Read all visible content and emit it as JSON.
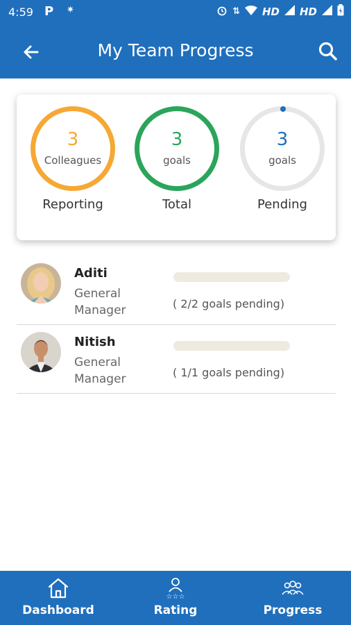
{
  "status_bar": {
    "time": "4:59",
    "network_1": "HD",
    "network_2": "HD"
  },
  "app_bar": {
    "title": "My Team Progress",
    "back_icon": "arrow-left-icon",
    "search_icon": "search-icon"
  },
  "summary": [
    {
      "value": "3",
      "unit": "Colleagues",
      "label": "Reporting",
      "color": "#f5a934",
      "progress": 1.0
    },
    {
      "value": "3",
      "unit": "goals",
      "label": "Total",
      "color": "#2aa55b",
      "progress": 1.0
    },
    {
      "value": "3",
      "unit": "goals",
      "label": "Pending",
      "color": "#1f6fbd",
      "progress": 0.0
    }
  ],
  "members": [
    {
      "name": "Aditi",
      "role": "General Manager",
      "pending": "( 2/2 goals pending)",
      "progress": 0.0
    },
    {
      "name": "Nitish",
      "role": "General Manager",
      "pending": "( 1/1 goals pending)",
      "progress": 0.0
    }
  ],
  "bottom_nav": [
    {
      "label": "Dashboard",
      "icon": "home-icon"
    },
    {
      "label": "Rating",
      "icon": "rating-icon"
    },
    {
      "label": "Progress",
      "icon": "team-icon"
    }
  ],
  "colors": {
    "primary": "#1f6fbd",
    "reporting": "#f5a934",
    "total": "#2aa55b",
    "ring_track": "#e6e6e6",
    "bar_track": "#eeeae0"
  }
}
